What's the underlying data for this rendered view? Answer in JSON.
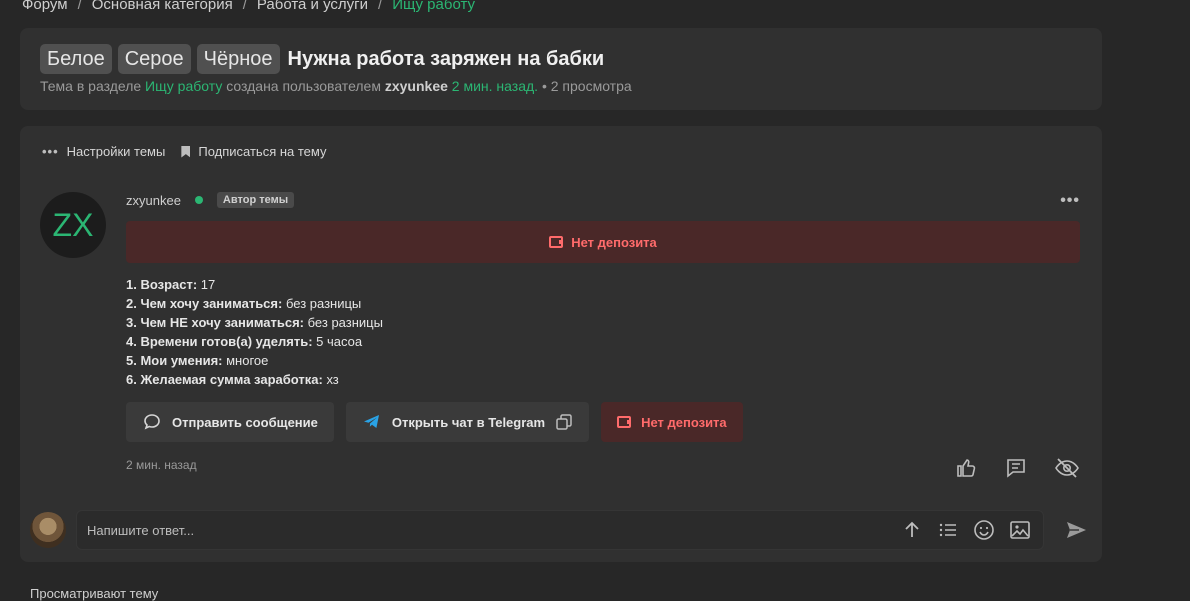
{
  "breadcrumb": {
    "items": [
      "Форум",
      "Основная категория",
      "Работа и услуги",
      "Ищу работу"
    ],
    "separator": "/"
  },
  "topic": {
    "tags": [
      "Белое",
      "Серое",
      "Чёрное"
    ],
    "title": "Нужна работа заряжен на бабки",
    "meta_prefix": "Тема в разделе",
    "section": "Ищу работу",
    "meta_created_by": "создана пользователем",
    "author": "zxyunkee",
    "created_ago": "2 мин. назад.",
    "views": "• 2 просмотра"
  },
  "topic_actions": {
    "settings": "Настройки темы",
    "subscribe": "Подписаться на тему"
  },
  "post": {
    "avatar_text": "ZX",
    "author": "zxyunkee",
    "author_badge": "Автор темы",
    "deposit_banner": "Нет депозита",
    "lines": [
      {
        "q": "1. Возраст:",
        "a": " 17"
      },
      {
        "q": "2. Чем хочу заниматься:",
        "a": " без разницы"
      },
      {
        "q": "3. Чем НЕ хочу заниматься:",
        "a": " без разницы"
      },
      {
        "q": "4. Времени готов(а) уделять:",
        "a": " 5 часоа"
      },
      {
        "q": "5. Мои умения:",
        "a": " многое"
      },
      {
        "q": "6. Желаемая сумма заработка:",
        "a": " хз"
      }
    ],
    "buttons": {
      "message": "Отправить сообщение",
      "telegram": "Открыть чат в Telegram",
      "deposit": "Нет депозита"
    },
    "time": "2 мин. назад"
  },
  "reply": {
    "placeholder": "Напишите ответ..."
  },
  "footer": {
    "viewing": "Просматривают тему"
  },
  "colors": {
    "accent": "#2bb673",
    "danger": "#ff6b6b",
    "danger_bg": "#4a2828",
    "bg": "#272727",
    "card": "#303030"
  }
}
